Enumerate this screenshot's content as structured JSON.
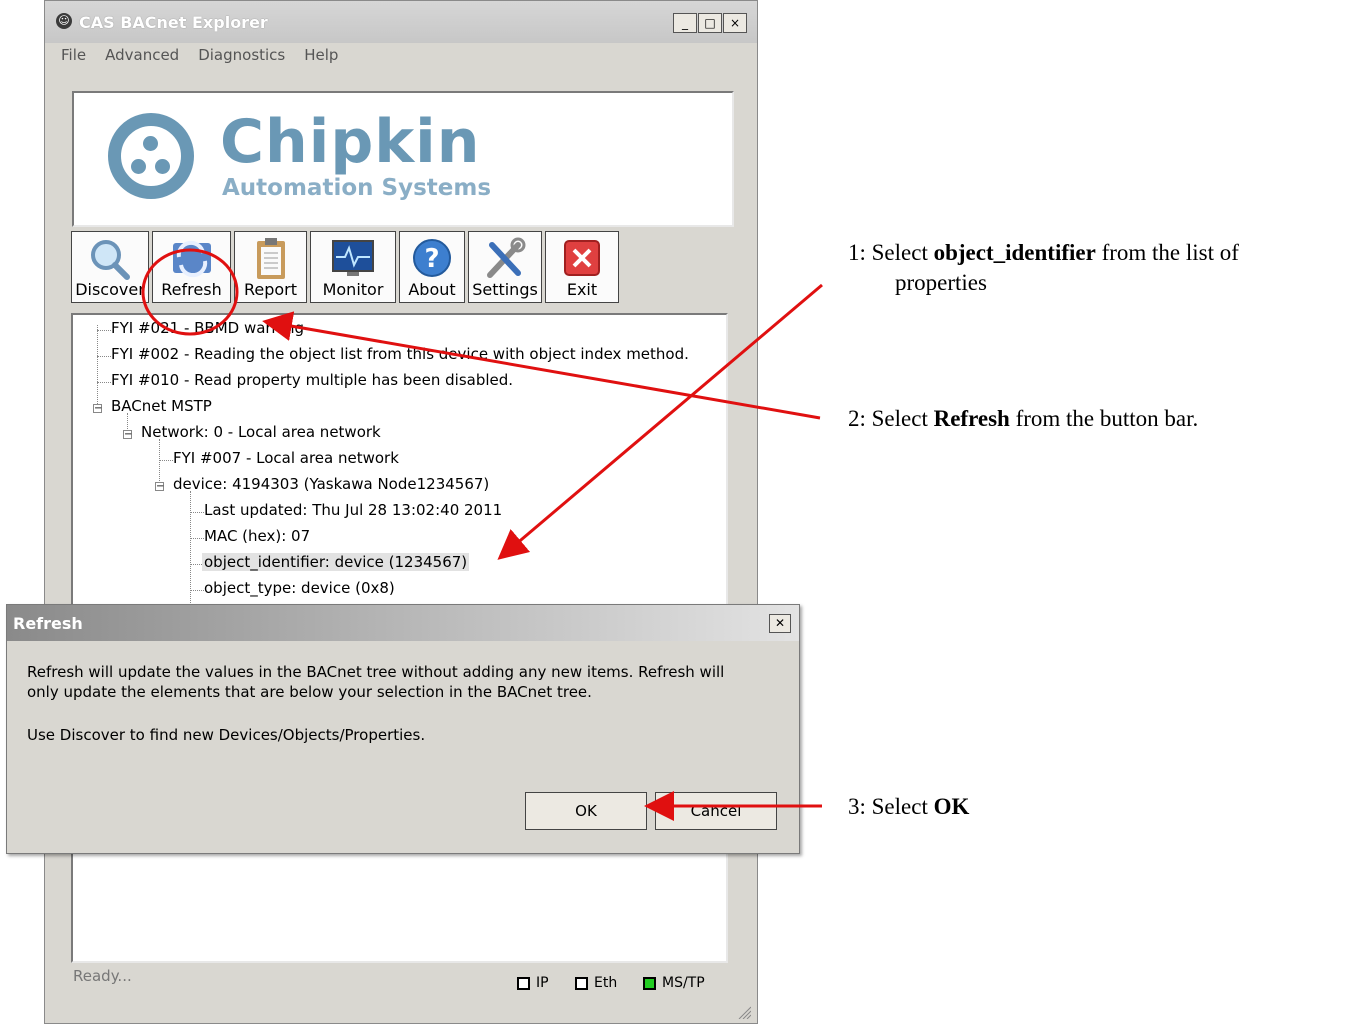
{
  "window": {
    "title": "CAS BACnet Explorer",
    "controls": [
      "_",
      "□",
      "×"
    ]
  },
  "menu": [
    "File",
    "Advanced",
    "Diagnostics",
    "Help"
  ],
  "logo": {
    "name": "Chipkin",
    "subtitle": "Automation Systems"
  },
  "toolbar": [
    {
      "label": "Discover",
      "icon": "magnifier-icon"
    },
    {
      "label": "Refresh",
      "icon": "refresh-icon"
    },
    {
      "label": "Report",
      "icon": "clipboard-icon"
    },
    {
      "label": "Monitor",
      "icon": "monitor-icon"
    },
    {
      "label": "About",
      "icon": "question-icon"
    },
    {
      "label": "Settings",
      "icon": "tools-icon"
    },
    {
      "label": "Exit",
      "icon": "exit-icon"
    }
  ],
  "tree": [
    "FYI #021 - BBMD warning",
    "FYI #002 - Reading the object list from this device with object index method.",
    "FYI #010 - Read property multiple has been disabled.",
    "BACnet MSTP",
    "Network: 0 - Local area network",
    "FYI #007 - Local area network",
    "device: 4194303  (Yaskawa Node1234567)",
    "Last updated: Thu Jul 28 13:02:40 2011",
    "MAC (hex): 07",
    "object_identifier: device (1234567)",
    "object_type: device (0x8)"
  ],
  "status": {
    "text": "Ready...",
    "indicators": [
      {
        "label": "IP",
        "color": "#ffffff"
      },
      {
        "label": "Eth",
        "color": "#ffffff"
      },
      {
        "label": "MS/TP",
        "color": "#22cc22"
      }
    ]
  },
  "dialog": {
    "title": "Refresh",
    "line1": "Refresh will update the values in the BACnet tree without adding any new items. Refresh will",
    "line2": "only update the elements that are below your selection in the BACnet tree.",
    "line3": "Use Discover to find new Devices/Objects/Properties.",
    "ok": "OK",
    "cancel": "Cancel"
  },
  "annotations": {
    "step1_prefix": "1:  Select ",
    "step1_bold": "object_identifier",
    "step1_suffix": " from the list of",
    "step1_line2": "properties",
    "step2_prefix": "2:  Select ",
    "step2_bold": "Refresh",
    "step2_suffix": " from the button bar.",
    "step3_prefix": "3:  Select ",
    "step3_bold": "OK",
    "arrow_color": "#e01010"
  }
}
